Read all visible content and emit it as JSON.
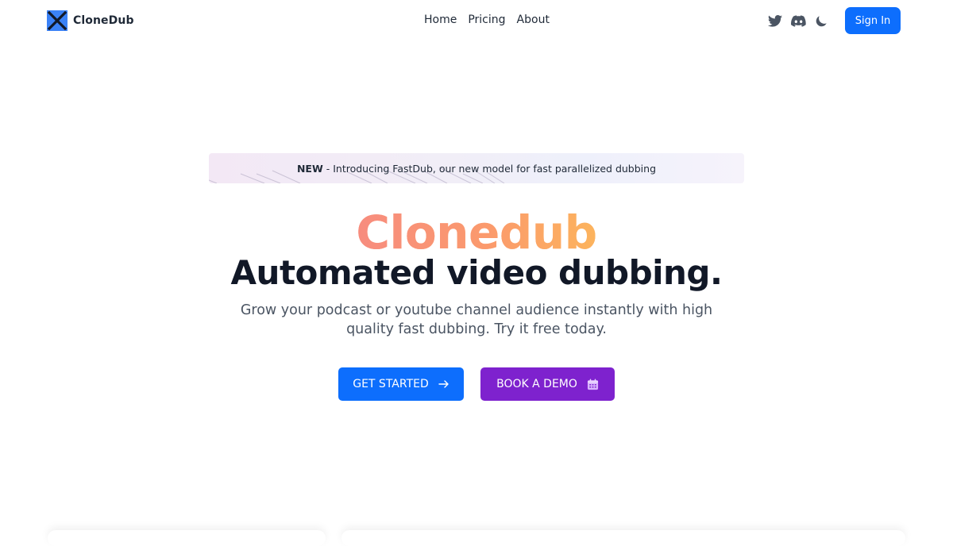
{
  "header": {
    "brand": {
      "name": "CloneDub",
      "logo_icon": "x-logo-icon",
      "logo_color": "#2563eb"
    },
    "nav": [
      {
        "label": "Home"
      },
      {
        "label": "Pricing"
      },
      {
        "label": "About"
      }
    ],
    "icons": [
      "twitter-icon",
      "discord-icon",
      "moon-icon"
    ],
    "sign_in_label": "Sign In"
  },
  "banner": {
    "badge": "NEW",
    "text": " - Introducing FastDub, our new model for fast parallelized dubbing"
  },
  "hero": {
    "title": "Clonedub",
    "subtitle": "Automated video dubbing.",
    "description": "Grow your podcast or youtube channel audience instantly with high quality fast dubbing. Try it free today."
  },
  "cta": {
    "primary": {
      "label": "GET STARTED",
      "icon": "arrow-right-icon"
    },
    "secondary": {
      "label": "BOOK A DEMO",
      "icon": "calendar-icon"
    }
  },
  "colors": {
    "primary": "#0d6efd",
    "secondary": "#7e22ce",
    "title_gradient_start": "#f78c7f",
    "title_gradient_end": "#fcb45d"
  }
}
